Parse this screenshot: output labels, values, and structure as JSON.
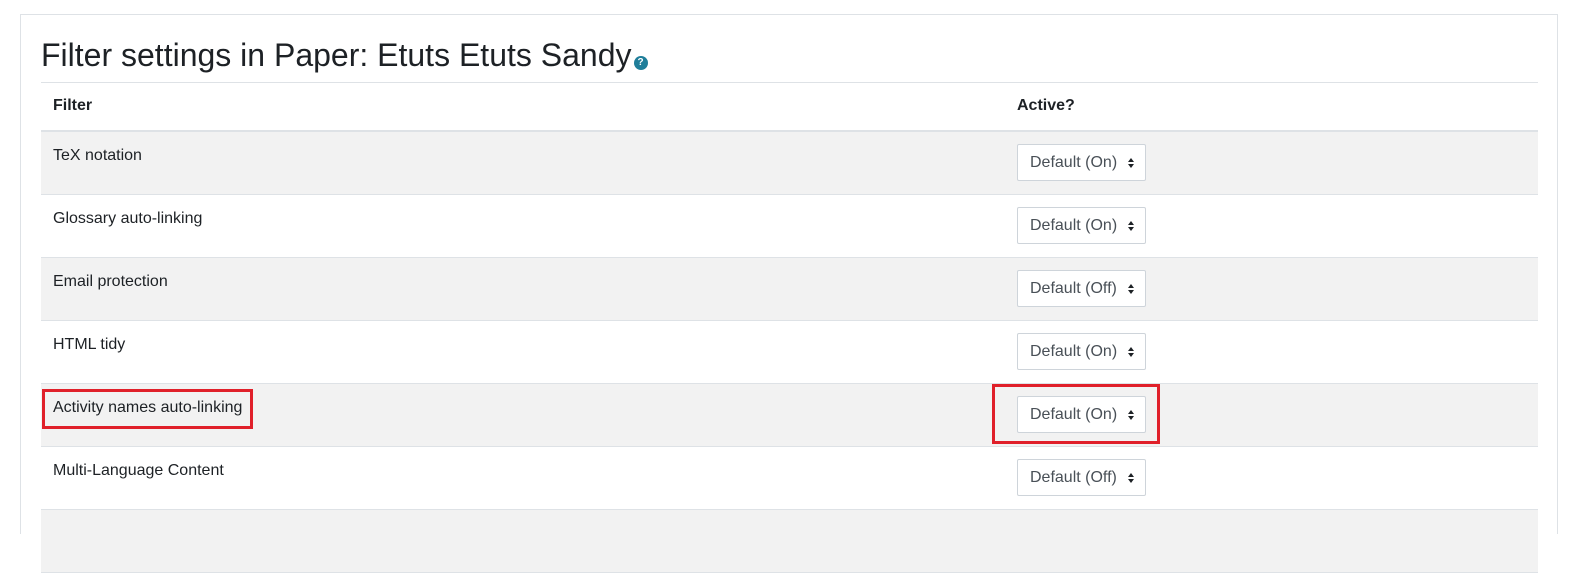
{
  "page": {
    "title": "Filter settings in Paper: Etuts Etuts Sandy",
    "help_icon": "?"
  },
  "table": {
    "headers": {
      "filter": "Filter",
      "active": "Active?"
    },
    "rows": [
      {
        "name": "TeX notation",
        "value": "Default (On)"
      },
      {
        "name": "Glossary auto-linking",
        "value": "Default (On)"
      },
      {
        "name": "Email protection",
        "value": "Default (Off)"
      },
      {
        "name": "HTML tidy",
        "value": "Default (On)"
      },
      {
        "name": "Activity names auto-linking",
        "value": "Default (On)"
      },
      {
        "name": "Multi-Language Content",
        "value": "Default (Off)"
      },
      {
        "name": "",
        "value": ""
      }
    ]
  },
  "select_icon": "up-down-caret-icon",
  "highlight_color": "#e0202a"
}
